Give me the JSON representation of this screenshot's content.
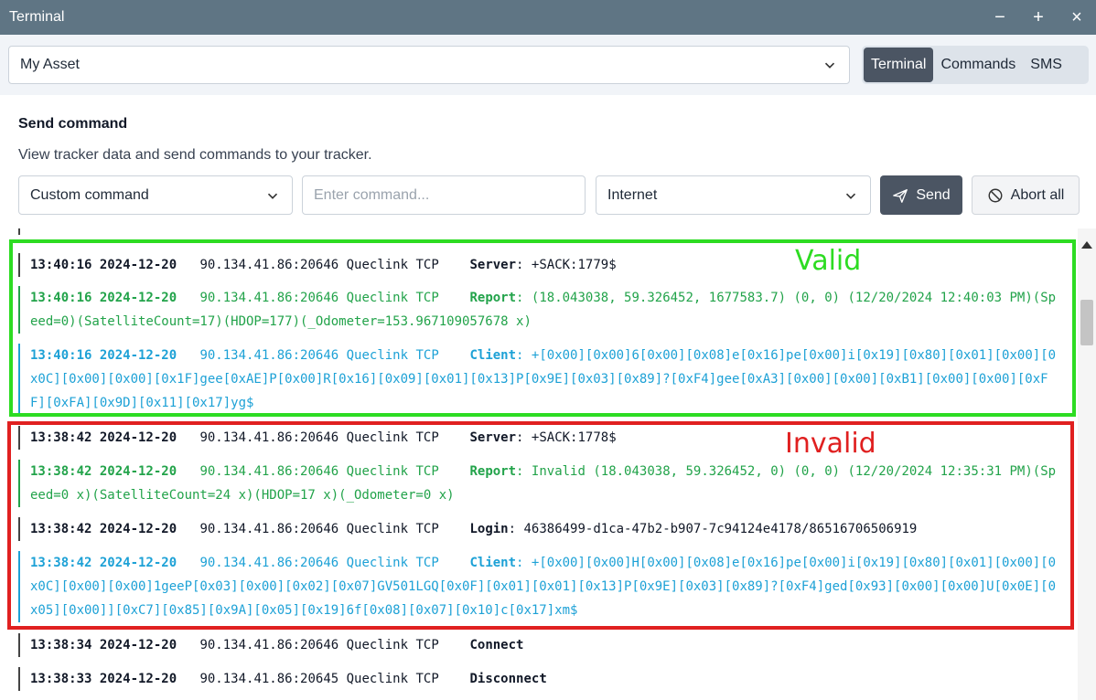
{
  "window": {
    "title": "Terminal",
    "minimize": "−",
    "maximize": "+",
    "close": "×"
  },
  "asset": {
    "value": "My Asset"
  },
  "tabs": [
    {
      "label": "Terminal",
      "active": true
    },
    {
      "label": "Commands",
      "active": false
    },
    {
      "label": "SMS",
      "active": false
    }
  ],
  "send_command": {
    "title": "Send command",
    "description": "View tracker data and send commands to your tracker.",
    "command_type": "Custom command",
    "command_placeholder": "Enter command...",
    "channel": "Internet",
    "send_label": "Send",
    "abort_label": "Abort all"
  },
  "annotations": {
    "valid": "Valid",
    "invalid": "Invalid"
  },
  "log": [
    {
      "time": "13:40:16 2024-12-20",
      "source": "90.134.41.86:20646 Queclink TCP",
      "type": "Server",
      "text": "+SACK:1779$",
      "color": "dark"
    },
    {
      "time": "13:40:16 2024-12-20",
      "source": "90.134.41.86:20646 Queclink TCP",
      "type": "Report",
      "text": "(18.043038, 59.326452, 1677583.7) (0, 0) (12/20/2024 12:40:03 PM)(Speed=0)(SatelliteCount=17)(HDOP=177)(_Odometer=153.967109057678 x)",
      "color": "green"
    },
    {
      "time": "13:40:16 2024-12-20",
      "source": "90.134.41.86:20646 Queclink TCP",
      "type": "Client",
      "text": "+[0x00][0x00]6[0x00][0x08]e[0x16]pe[0x00]i[0x19][0x80][0x01][0x00][0x0C][0x00][0x00][0x1F]gee[0xAE]P[0x00]R[0x16][0x09][0x01][0x13]P[0x9E][0x03][0x89]?[0xF4]gee[0xA3][0x00][0x00][0xB1][0x00][0x00][0xFF][0xFA][0x9D][0x11][0x17]yg$",
      "color": "blue"
    },
    {
      "time": "13:38:42 2024-12-20",
      "source": "90.134.41.86:20646 Queclink TCP",
      "type": "Server",
      "text": "+SACK:1778$",
      "color": "dark"
    },
    {
      "time": "13:38:42 2024-12-20",
      "source": "90.134.41.86:20646 Queclink TCP",
      "type": "Report",
      "text": "Invalid (18.043038, 59.326452, 0) (0, 0) (12/20/2024 12:35:31 PM)(Speed=0 x)(SatelliteCount=24 x)(HDOP=17 x)(_Odometer=0 x)",
      "color": "green"
    },
    {
      "time": "13:38:42 2024-12-20",
      "source": "90.134.41.86:20646 Queclink TCP",
      "type": "Login",
      "text": "46386499-d1ca-47b2-b907-7c94124e4178/86516706506919",
      "color": "dark"
    },
    {
      "time": "13:38:42 2024-12-20",
      "source": "90.134.41.86:20646 Queclink TCP",
      "type": "Client",
      "text": "+[0x00][0x00]H[0x00][0x08]e[0x16]pe[0x00]i[0x19][0x80][0x01][0x00][0x0C][0x00][0x00]1geeP[0x03][0x00][0x02][0x07]GV501LGQ[0x0F][0x01][0x01][0x13]P[0x9E][0x03][0x89]?[0xF4]ged[0x93][0x00][0x00]U[0x0E][0x05][0x00]][0xC7][0x85][0x9A][0x05][0x19]6f[0x08][0x07][0x10]c[0x17]xm$",
      "color": "blue"
    },
    {
      "time": "13:38:34 2024-12-20",
      "source": "90.134.41.86:20646 Queclink TCP",
      "type": "Connect",
      "text": "",
      "color": "dark"
    },
    {
      "time": "13:38:33 2024-12-20",
      "source": "90.134.41.86:20645 Queclink TCP",
      "type": "Disconnect",
      "text": "",
      "color": "dark"
    }
  ]
}
